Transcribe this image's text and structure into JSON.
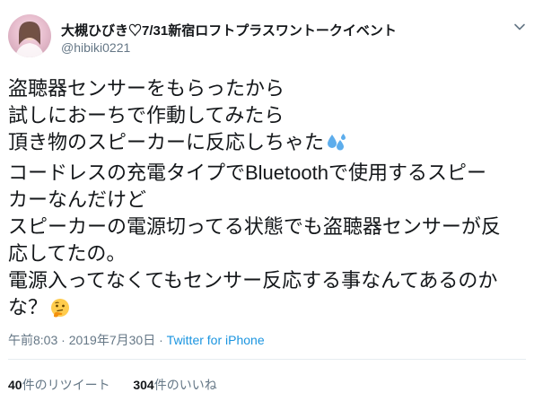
{
  "author": {
    "display_name": "大槻ひびき♡7/31新宿ロフトプラスワントークイベント",
    "handle": "@hibiki0221"
  },
  "tweet": {
    "lines": [
      "盗聴器センサーをもらったから",
      "試しにおーちで作動してみたら",
      "頂き物のスピーカーに反応しちゃた",
      "コードレスの充電タイプでBluetoothで使用するスピー",
      "カーなんだけど",
      "スピーカーの電源切ってる状態でも盗聴器センサーが反",
      "応してたの。",
      "電源入ってなくてもセンサー反応する事なんてあるのか",
      "な？"
    ],
    "emojis": {
      "line3": "sweat-droplets-icon",
      "line9": "thinking-face-icon"
    }
  },
  "meta": {
    "time": "午前8:03",
    "sep1": " · ",
    "date": "2019年7月30日",
    "sep2": " · ",
    "source": "Twitter for iPhone"
  },
  "stats": {
    "retweets_count": "40",
    "retweets_label": "件のリツイート",
    "likes_count": "304",
    "likes_label": "件のいいね"
  },
  "colors": {
    "text": "#14171a",
    "secondary": "#657786",
    "link": "#1b95e0",
    "divider": "#e6ecf0"
  }
}
